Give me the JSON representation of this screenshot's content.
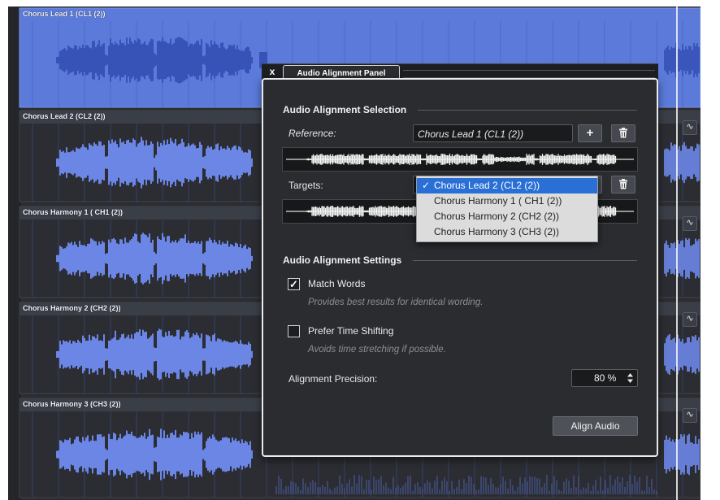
{
  "tracks": [
    {
      "label": "Chorus Lead 1 (CL1 (2))"
    },
    {
      "label": "Chorus Lead 2 (CL2 (2))"
    },
    {
      "label": "Chorus Harmony 1 ( CH1 (2))"
    },
    {
      "label": "Chorus Harmony 2 (CH2 (2))"
    },
    {
      "label": "Chorus Harmony 3 (CH3 (2))"
    }
  ],
  "track_waveform_button": "∿",
  "panel": {
    "close": "x",
    "tab": "Audio Alignment Panel",
    "selection_title": "Audio Alignment Selection",
    "reference_label": "Reference:",
    "reference_value": "Chorus Lead 1 (CL1 (2))",
    "add_symbol": "+",
    "targets_label": "Targets:",
    "settings_title": "Audio Alignment Settings",
    "match_words": {
      "label": "Match Words",
      "checked": true,
      "mark": "✓",
      "desc": "Provides best results for identical wording."
    },
    "prefer_time_shifting": {
      "label": "Prefer Time Shifting",
      "checked": false,
      "desc": "Avoids time stretching if possible."
    },
    "precision_label": "Alignment Precision:",
    "precision_value": "80 %",
    "align_button": "Align Audio"
  },
  "targets_dropdown": {
    "check": "✓",
    "options": [
      "Chorus Lead 2 (CL2 (2))",
      "Chorus Harmony 1 ( CH1 (2))",
      "Chorus Harmony 2 (CH2 (2))",
      "Chorus Harmony 3 (CH3 (2))"
    ],
    "selected_index": 0
  },
  "colors": {
    "lead_track": "#5b7ad9",
    "track_bg": "#2b2d33",
    "wave": "#6c86e6",
    "selection_blue": "#2a6fd6"
  }
}
